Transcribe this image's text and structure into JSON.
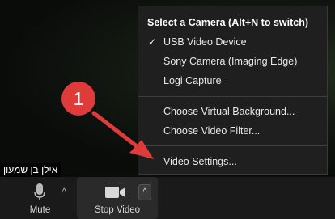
{
  "participant": {
    "name": "אילן בן שמעון"
  },
  "camera_menu": {
    "header": "Select a Camera (Alt+N to switch)",
    "cameras": [
      {
        "label": "USB Video Device",
        "selected": true
      },
      {
        "label": "Sony Camera (Imaging Edge)",
        "selected": false
      },
      {
        "label": "Logi Capture",
        "selected": false
      }
    ],
    "actions": [
      {
        "label": "Choose Virtual Background..."
      },
      {
        "label": "Choose Video Filter..."
      }
    ],
    "settings": {
      "label": "Video Settings..."
    },
    "check_glyph": "✓"
  },
  "toolbar": {
    "mute_label": "Mute",
    "stop_video_label": "Stop Video",
    "caret_glyph": "^"
  },
  "annotation": {
    "step_number": "1",
    "color": "#e03b3b"
  }
}
